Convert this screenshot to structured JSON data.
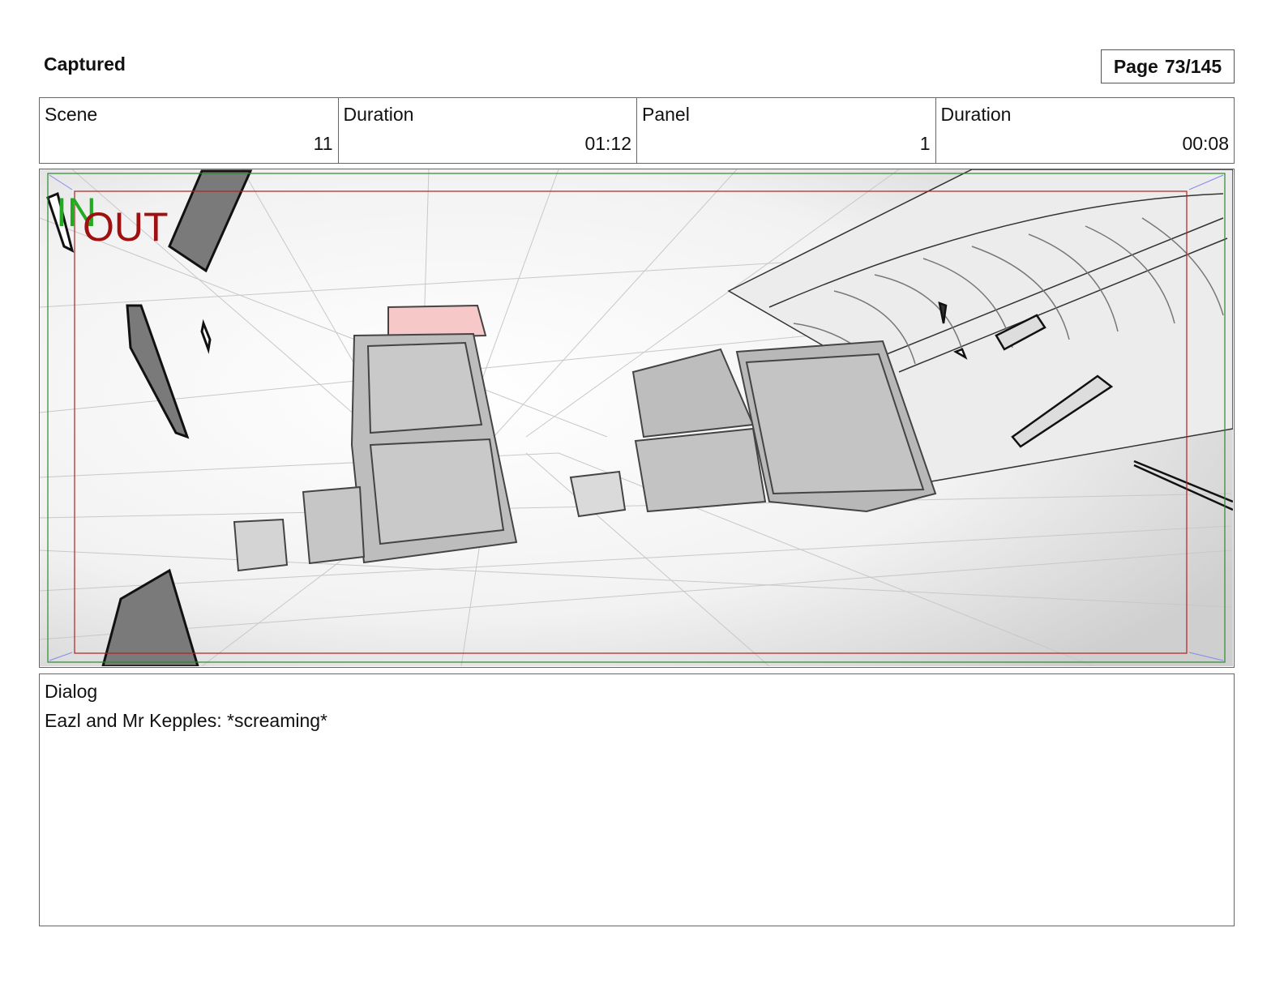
{
  "header": {
    "title": "Captured",
    "page_label": "Page",
    "page_value": "73/145"
  },
  "info": {
    "scene_label": "Scene",
    "scene_value": "11",
    "scene_duration_label": "Duration",
    "scene_duration_value": "01:12",
    "panel_label": "Panel",
    "panel_value": "1",
    "panel_duration_label": "Duration",
    "panel_duration_value": "00:08"
  },
  "panel": {
    "in_marker": "IN",
    "out_marker": "OUT",
    "in_color": "#22aa22",
    "out_color": "#a01010"
  },
  "dialog": {
    "label": "Dialog",
    "text": "Eazl and Mr Kepples: *screaming*"
  }
}
